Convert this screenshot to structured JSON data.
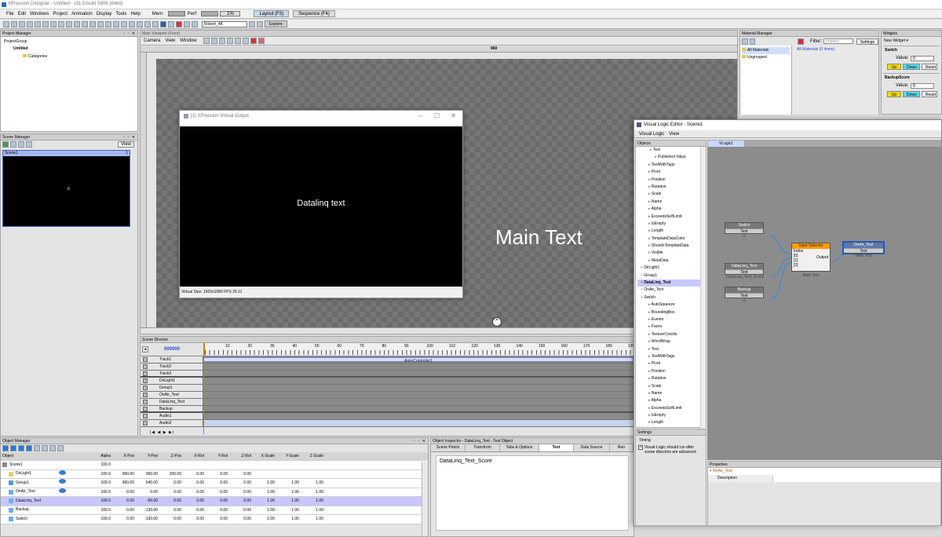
{
  "app": {
    "title": "XPression Designer - Untitled - v11.5 build 5806 (64bit)"
  },
  "menu": [
    "File",
    "Edit",
    "Windows",
    "Project",
    "Animation",
    "Display",
    "Tools",
    "Help"
  ],
  "status": {
    "mem_label": "Mem:",
    "perf_label": "Perf:",
    "perf_value": "1%"
  },
  "layout_tabs": [
    "Layout (F3)",
    "Sequence (F4)"
  ],
  "toolbar": {
    "user": "Robert_4K",
    "explore": "Explore"
  },
  "project_manager": {
    "title": "Project Manager",
    "items": [
      "ProjectGroup",
      "Untitled",
      "Categories"
    ]
  },
  "scene_manager": {
    "title": "Scene Manager",
    "view": "View",
    "scene": "Scene1",
    "scene_num": "1",
    "preview_label": "0"
  },
  "viewport": {
    "title": "Main Viewport (Front)",
    "menu": [
      "Camera",
      "View",
      "Window"
    ],
    "ruler_mark": "960",
    "main_text": "Main Text"
  },
  "virtual_output": {
    "title": "[1] XPression Virtual Output",
    "text": "Datalinq text",
    "footer": "Virtual Size: 1920x1080  FPS 25.11"
  },
  "scene_director": {
    "title": "Scene Director",
    "time": "000000",
    "ticks": [
      "10",
      "20",
      "30",
      "40",
      "50",
      "60",
      "70",
      "80",
      "90",
      "100",
      "110",
      "120",
      "130",
      "140",
      "150",
      "160",
      "170",
      "180",
      "190"
    ],
    "clip": "AnimController1",
    "tracks": [
      "Track1",
      "Track2",
      "Track3",
      "DirLight1",
      "Group1",
      "OnAir_Text",
      "DataLinq_Text",
      "Backup",
      "Audio1",
      "Audio2"
    ]
  },
  "object_manager": {
    "title": "Object Manager",
    "columns": [
      "Object",
      "Alpha",
      "X-Pos",
      "Y-Pos",
      "Z-Pos",
      "X-Rot",
      "Y-Rot",
      "Z-Rot",
      "X-Scale",
      "Y-Scale",
      "Z-Scale"
    ],
    "rows": [
      {
        "name": "Scene1",
        "vals": [
          "100.0",
          "",
          "",
          "",
          "",
          "",
          "",
          "",
          "",
          ""
        ]
      },
      {
        "name": "DirLight1",
        "vals": [
          "100.0",
          "960.00",
          "360.00",
          "200.00",
          "0.00",
          "0.00",
          "0.00",
          "",
          "",
          ""
        ]
      },
      {
        "name": "Group1",
        "vals": [
          "100.0",
          "960.00",
          "540.00",
          "0.00",
          "0.00",
          "0.00",
          "0.00",
          "1.00",
          "1.00",
          "1.00"
        ]
      },
      {
        "name": "OnAir_Text",
        "vals": [
          "100.0",
          "0.00",
          "0.00",
          "0.00",
          "0.00",
          "0.00",
          "0.00",
          "1.00",
          "1.00",
          "1.00"
        ]
      },
      {
        "name": "DataLinq_Text",
        "vals": [
          "100.0",
          "0.00",
          "-65.00",
          "0.00",
          "0.00",
          "0.00",
          "0.00",
          "1.00",
          "1.00",
          "1.00"
        ]
      },
      {
        "name": "Backup",
        "vals": [
          "100.0",
          "0.00",
          "-130.00",
          "0.00",
          "0.00",
          "0.00",
          "0.00",
          "1.00",
          "1.00",
          "1.00"
        ]
      },
      {
        "name": "Switch",
        "vals": [
          "100.0",
          "0.00",
          "-130.00",
          "0.00",
          "0.00",
          "0.00",
          "0.00",
          "1.00",
          "1.00",
          "1.00"
        ]
      }
    ]
  },
  "object_inspector": {
    "title": "Object Inspector - DataLinq_Text - Text Object",
    "tabs": [
      "Scene Points",
      "Transform",
      "Tabs & Options",
      "Text",
      "Data Source",
      "Ren"
    ],
    "text_value": "DataLinq_Text_Score"
  },
  "material_manager": {
    "title": "Material Manager",
    "filter_label": "Filter:",
    "filter_placeholder": "<none>",
    "settings": "Settings",
    "tree": [
      "All Materials",
      "Ungrouped"
    ],
    "list_header": "All Materials (0 items)"
  },
  "widgets": {
    "title": "Widgets",
    "new_widget": "New Widget",
    "groups": [
      {
        "name": "Switch",
        "value_label": "Value:",
        "value": "0",
        "up": "Up",
        "down": "Down",
        "reset": "Reset"
      },
      {
        "name": "BackupScore",
        "value_label": "Value:",
        "value": "0",
        "up": "Up",
        "down": "Down",
        "reset": "Reset"
      }
    ]
  },
  "vle": {
    "title": "Visual Logic Editor - Scene1",
    "menu": [
      "Visual Logic",
      "View"
    ],
    "objects_label": "Objects",
    "tab": "VLogic1",
    "tree": [
      "Text",
      "Published Value",
      "TextWithTags",
      "Pivot",
      "Position",
      "Rotation",
      "Scale",
      "Name",
      "Alpha",
      "ExceedsSoftLimit",
      "IsEmpty",
      "Length",
      "TemplateDataColor",
      "ShowInTemplateData",
      "Visible",
      "MetaData",
      "DirLight1",
      "Group1",
      "DataLinq_Text",
      "OnAir_Text",
      "Switch",
      "AutoSqueeze",
      "BoundingBox",
      "Events",
      "Faces",
      "TextureCoords",
      "WordWrap",
      "Text",
      "TextWithTags",
      "Pivot",
      "Position",
      "Rotation",
      "Scale",
      "Name",
      "Alpha",
      "ExceedsSoftLimit",
      "IsEmpty",
      "Length"
    ],
    "settings_label": "Settings",
    "timing_label": "Timing",
    "timing_text": "Visual Logic should run after scene directors are advanced",
    "properties_label": "Properties",
    "prop_obj": "OnAir_Text",
    "prop_desc": "Description",
    "nodes": {
      "switch": {
        "title": "Switch",
        "port": "Text",
        "sub": "0"
      },
      "datalinq": {
        "title": "DataLinq_Text",
        "port": "Text",
        "sub": "DataLinq_Text_Score"
      },
      "backup": {
        "title": "Backup",
        "port": "Text",
        "sub": "0"
      },
      "selector": {
        "title": "Input Selector",
        "index": "Index",
        "in0": "[0]",
        "in1": "[1]",
        "in2": "[2]",
        "output": "Output",
        "sub": "Main Text"
      },
      "onair": {
        "title": "OnAir_Text",
        "port": "Text",
        "sub": "Main Text"
      }
    }
  },
  "colors": {
    "accent": "#ff9a00",
    "selection": "#c8c8ff",
    "up": "#f0d800",
    "down": "#58d8f0"
  }
}
